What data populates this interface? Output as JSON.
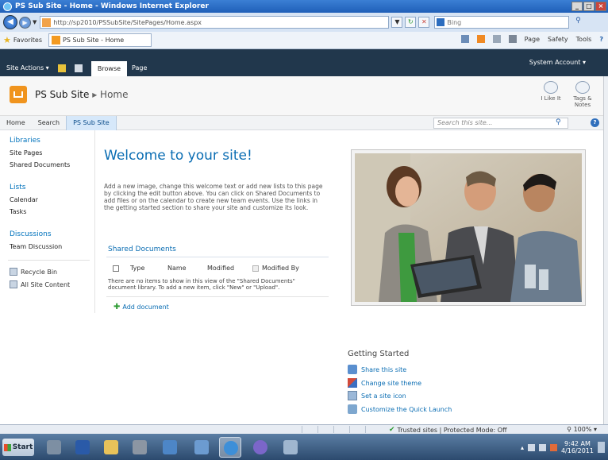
{
  "window": {
    "title": "PS Sub Site - Home - Windows Internet Explorer"
  },
  "browser": {
    "url": "http://sp2010/PSSubSite/SitePages/Home.aspx",
    "search_placeholder": "Bing",
    "favorites_label": "Favorites",
    "tab_title": "PS Sub Site - Home",
    "commands": [
      "Page",
      "Safety",
      "Tools"
    ],
    "status": {
      "zone": "Trusted sites | Protected Mode: Off",
      "zoom": "100%"
    }
  },
  "ribbon": {
    "site_actions": "Site Actions",
    "tabs": [
      "Browse",
      "Page"
    ],
    "account": "System Account"
  },
  "site": {
    "title": "PS Sub Site",
    "page": "Home",
    "social": [
      {
        "label": "I Like It"
      },
      {
        "label": "Tags &",
        "label2": "Notes"
      }
    ]
  },
  "topnav": {
    "items": [
      "Home",
      "Search",
      "PS Sub Site"
    ],
    "search_placeholder": "Search this site..."
  },
  "quicklaunch": {
    "libraries": {
      "heading": "Libraries",
      "items": [
        "Site Pages",
        "Shared Documents"
      ]
    },
    "lists": {
      "heading": "Lists",
      "items": [
        "Calendar",
        "Tasks"
      ]
    },
    "discussions": {
      "heading": "Discussions",
      "items": [
        "Team Discussion"
      ]
    },
    "bottom": [
      "Recycle Bin",
      "All Site Content"
    ]
  },
  "main": {
    "heading": "Welcome to your site!",
    "intro": "Add a new image, change this welcome text or add new lists to this page by clicking the edit button above. You can click on Shared Documents to add files or on the calendar to create new team events. Use the links in the getting started section to share your site and customize its look.",
    "doclib": {
      "title": "Shared Documents",
      "columns": [
        "Type",
        "Name",
        "Modified",
        "Modified By"
      ],
      "empty": "There are no items to show in this view of the \"Shared Documents\" document library. To add a new item, click \"New\" or \"Upload\".",
      "add_label": "Add document"
    },
    "getting_started": {
      "title": "Getting Started",
      "links": [
        "Share this site",
        "Change site theme",
        "Set a site icon",
        "Customize the Quick Launch"
      ]
    }
  },
  "taskbar": {
    "start": "Start",
    "time": "9:42 AM",
    "date": "4/16/2011"
  },
  "colors": {
    "ribbon_bg": "#21374c",
    "link_blue": "#0a6db3",
    "nav_selected": "#d6e8fa"
  }
}
